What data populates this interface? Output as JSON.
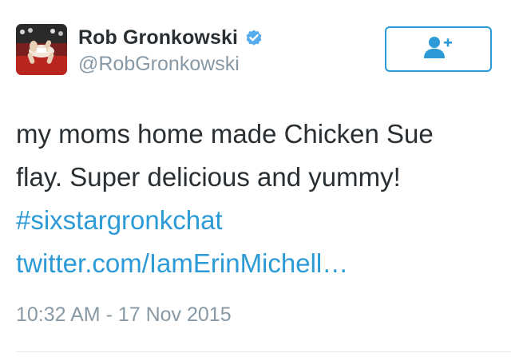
{
  "tweet": {
    "author": {
      "display_name": "Rob Gronkowski",
      "handle": "@RobGronkowski",
      "verified": true,
      "avatar_icon": "profile-photo"
    },
    "follow_button": {
      "icon": "add-user-icon"
    },
    "text_lines": [
      "my moms home made Chicken Sue",
      "flay. Super delicious and yummy!"
    ],
    "hashtag": "#sixstargronkchat",
    "link": "twitter.com/IamErinMichell…",
    "timestamp": "10:32 AM - 17 Nov 2015"
  },
  "colors": {
    "link": "#2b9ad6",
    "text": "#292f33",
    "secondary": "#8899a6",
    "verified": "#55acee"
  }
}
